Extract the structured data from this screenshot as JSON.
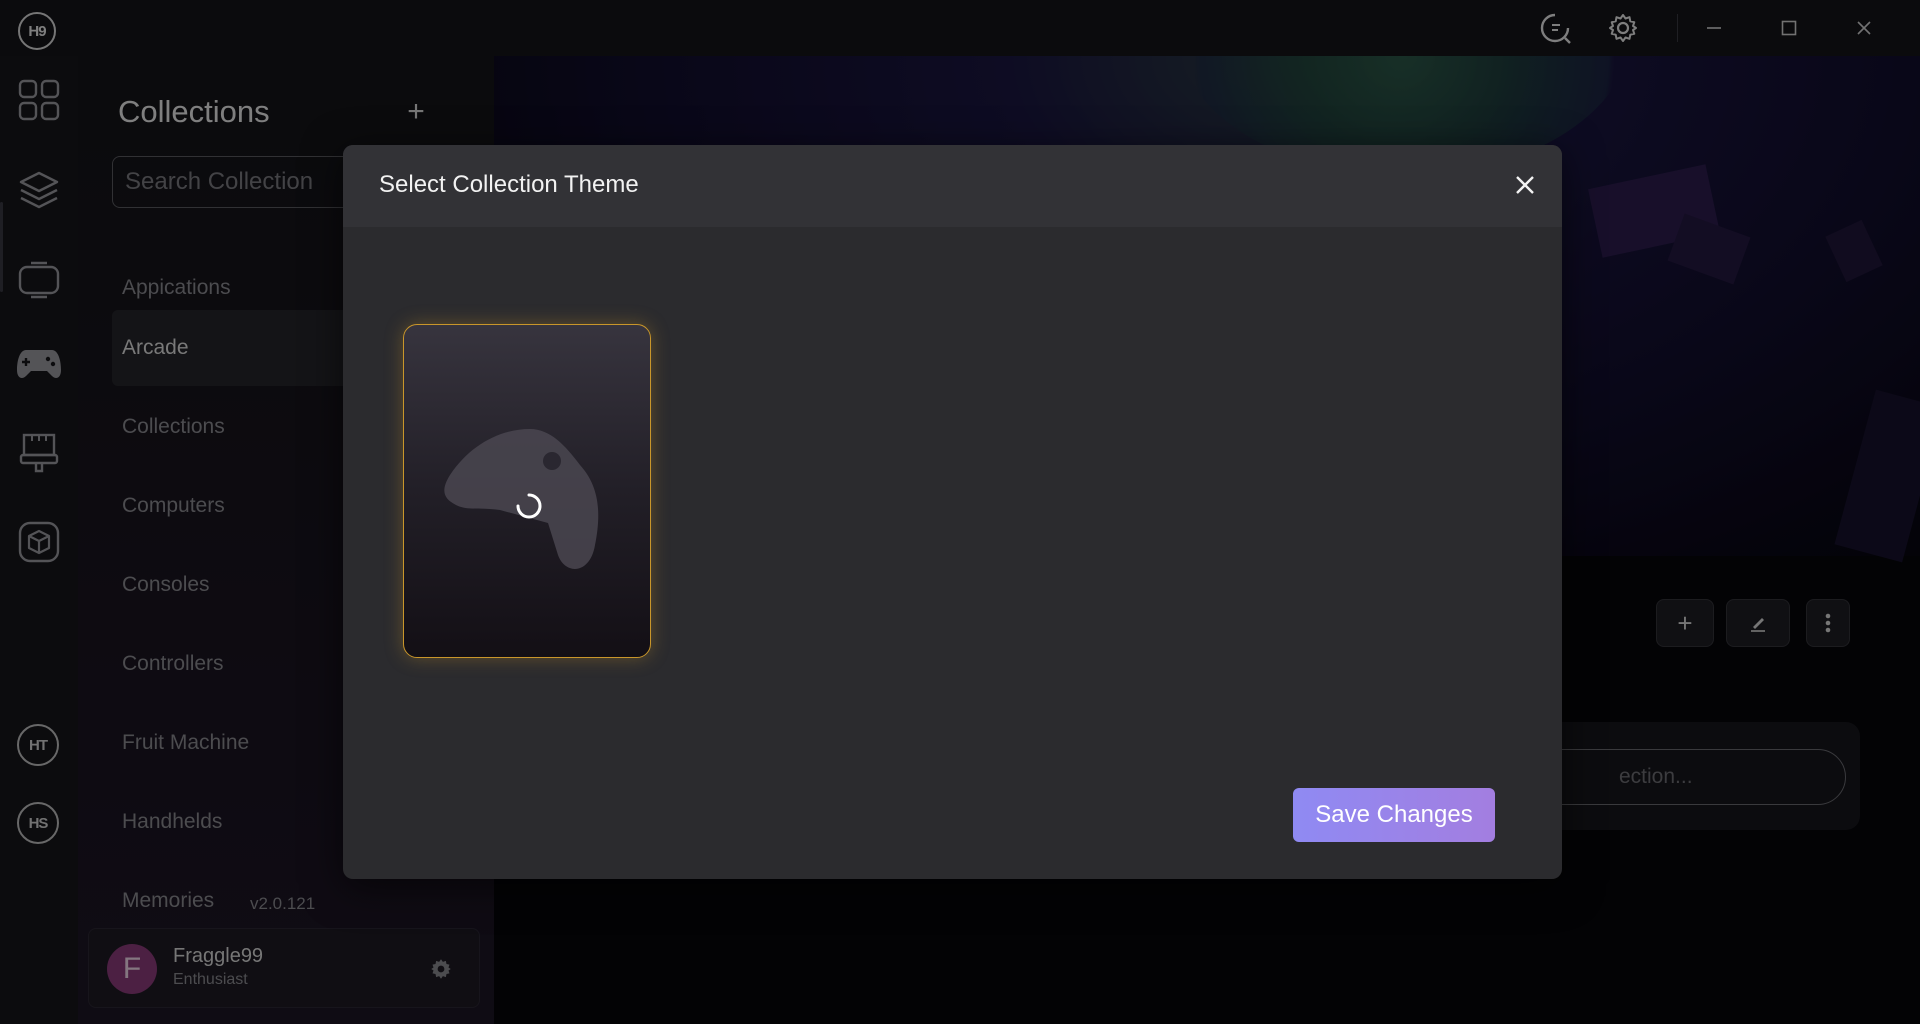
{
  "app": {
    "logo_text": "H9"
  },
  "titlebar": {
    "icons": [
      "search-refresh-icon",
      "gear-icon",
      "minimize-icon",
      "maximize-icon",
      "close-icon"
    ]
  },
  "rail": {
    "icons": [
      "grid-icon",
      "layers-icon",
      "tablet-icon",
      "gamepad-icon",
      "arcade-cabinet-icon",
      "cube-icon"
    ],
    "badges": [
      "HT",
      "HS"
    ]
  },
  "sidebar": {
    "title": "Collections",
    "add_label": "+",
    "search_placeholder": "Search Collection",
    "items": [
      {
        "label": "Appications"
      },
      {
        "label": "Arcade"
      },
      {
        "label": "Collections"
      },
      {
        "label": "Computers"
      },
      {
        "label": "Consoles"
      },
      {
        "label": "Controllers"
      },
      {
        "label": "Fruit Machine"
      },
      {
        "label": "Handhelds"
      },
      {
        "label": "Memories"
      }
    ],
    "selected_item": "Arcade",
    "version": "v2.0.121",
    "user": {
      "initial": "F",
      "name": "Fraggle99",
      "role": "Enthusiast"
    }
  },
  "main": {
    "actions": [
      {
        "label": "+",
        "icon": "plus-icon"
      },
      {
        "icon": "edit-icon"
      },
      {
        "icon": "more-vertical-icon"
      }
    ],
    "background_input_text": "ection..."
  },
  "modal": {
    "title": "Select Collection Theme",
    "save_label": "Save Changes",
    "card_icon": "controller-icon",
    "loading": true
  },
  "colors": {
    "accent_gradient_start": "#8f8af3",
    "accent_gradient_end": "#a37ee0",
    "card_border": "#c9962a",
    "avatar_bg": "#8a3b7a"
  }
}
